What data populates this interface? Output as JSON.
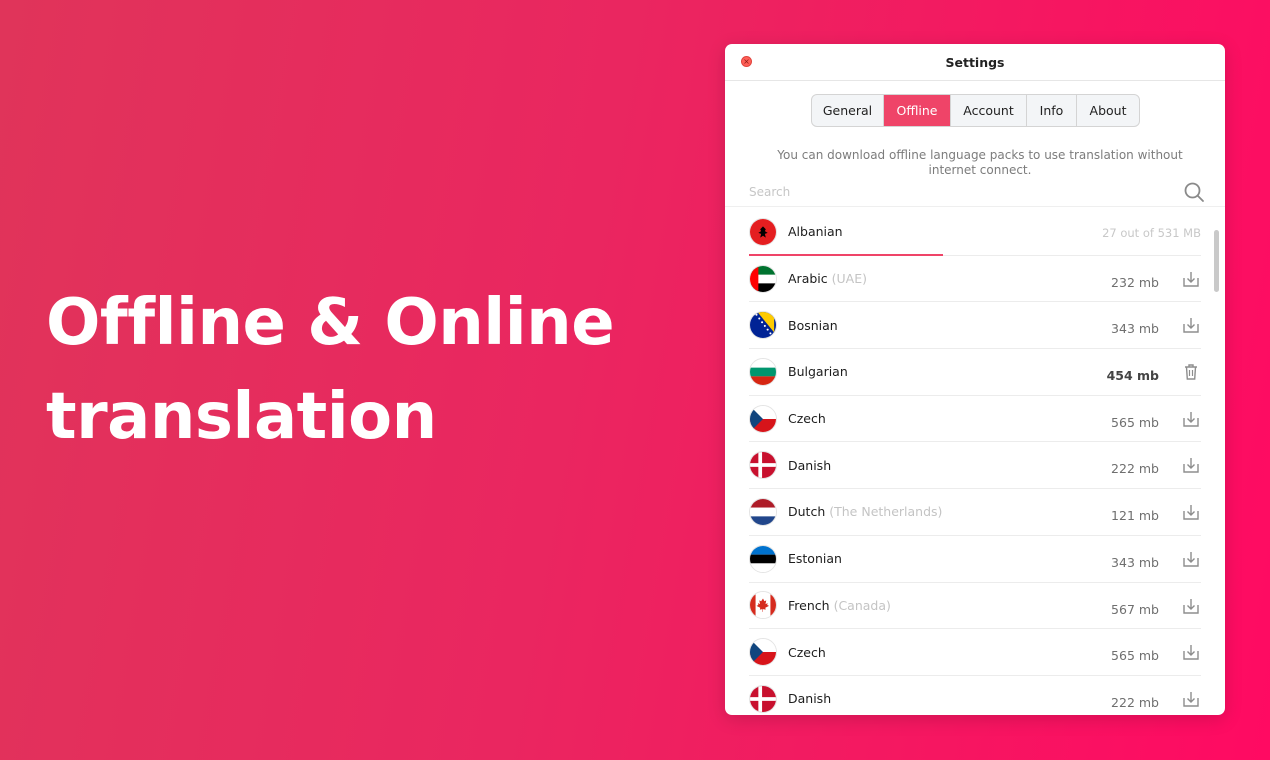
{
  "headline": {
    "line1": "Offline & Online",
    "line2": "translation"
  },
  "window": {
    "title": "Settings",
    "close_glyph": "×",
    "tabs": [
      {
        "label": "General"
      },
      {
        "label": "Offline",
        "active": true
      },
      {
        "label": "Account"
      },
      {
        "label": "Info"
      },
      {
        "label": "About"
      }
    ],
    "description": "You can download offline language packs to use translation without internet connect.",
    "search": {
      "placeholder": "Search",
      "icon": "search-icon"
    },
    "languages": [
      {
        "name": "Albanian",
        "region": "",
        "size": "",
        "progress_text": "27 out of 531 MB",
        "progress": 0.43,
        "state": "downloading",
        "flag": "albania"
      },
      {
        "name": "Arabic",
        "region": "(UAE)",
        "size": "232 mb",
        "state": "available",
        "action_icon": "download-icon",
        "flag": "uae"
      },
      {
        "name": "Bosnian",
        "region": "",
        "size": "343 mb",
        "state": "available",
        "action_icon": "download-icon",
        "flag": "bosnia"
      },
      {
        "name": "Bulgarian",
        "region": "",
        "size": "454 mb",
        "state": "downloaded",
        "action_icon": "trash-icon",
        "flag": "bulgaria"
      },
      {
        "name": "Czech",
        "region": "",
        "size": "565 mb",
        "state": "available",
        "action_icon": "download-icon",
        "flag": "czech"
      },
      {
        "name": "Danish",
        "region": "",
        "size": "222 mb",
        "state": "available",
        "action_icon": "download-icon",
        "flag": "denmark"
      },
      {
        "name": "Dutch",
        "region": "(The Netherlands)",
        "size": "121 mb",
        "state": "available",
        "action_icon": "download-icon",
        "flag": "netherlands"
      },
      {
        "name": "Estonian",
        "region": "",
        "size": "343 mb",
        "state": "available",
        "action_icon": "download-icon",
        "flag": "estonia"
      },
      {
        "name": "French",
        "region": "(Canada)",
        "size": "567 mb",
        "state": "available",
        "action_icon": "download-icon",
        "flag": "canada"
      },
      {
        "name": "Czech",
        "region": "",
        "size": "565 mb",
        "state": "available",
        "action_icon": "download-icon",
        "flag": "czech"
      },
      {
        "name": "Danish",
        "region": "",
        "size": "222 mb",
        "state": "available",
        "action_icon": "download-icon",
        "flag": "denmark"
      }
    ]
  },
  "colors": {
    "accent": "#ef4468",
    "background_start": "#e0345a",
    "background_end": "#ff0a62"
  }
}
